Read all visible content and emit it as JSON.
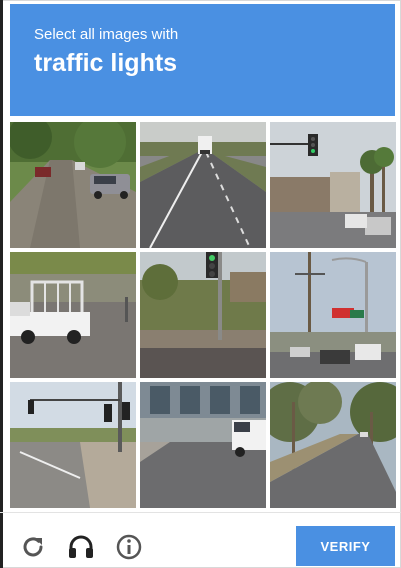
{
  "header": {
    "instruction": "Select all images with",
    "target": "traffic lights"
  },
  "grid": {
    "tiles": [
      {
        "scene": "residential street with parked cars"
      },
      {
        "scene": "highway with truck"
      },
      {
        "scene": "intersection with traffic light and palm trees"
      },
      {
        "scene": "white pickup truck with rack"
      },
      {
        "scene": "traffic light pole near hillside"
      },
      {
        "scene": "street with signs and utility poles"
      },
      {
        "scene": "road with traffic lights on pole"
      },
      {
        "scene": "storefront with white truck"
      },
      {
        "scene": "tree-lined road"
      }
    ]
  },
  "footer": {
    "reload_icon": "reload-icon",
    "audio_icon": "headphones-icon",
    "info_icon": "info-icon",
    "verify_label": "VERIFY"
  },
  "colors": {
    "accent": "#4a90e2",
    "footer_icon": "#555555"
  }
}
